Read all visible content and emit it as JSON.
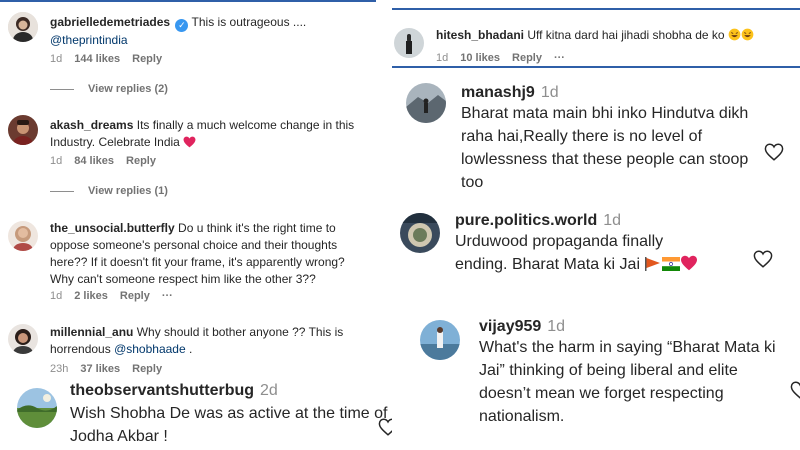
{
  "left_panel": {
    "comments": [
      {
        "username": "gabrielledemetriades",
        "text": "This is outrageous ....",
        "mention": "@theprintindia",
        "time": "1d",
        "likes": "144 likes",
        "reply": "Reply",
        "view_replies": "View replies (2)"
      },
      {
        "username": "akash_dreams",
        "text": "Its finally a much welcome change in this Industry. Celebrate India",
        "time": "1d",
        "likes": "84 likes",
        "reply": "Reply",
        "view_replies": "View replies (1)"
      },
      {
        "username": "the_unsocial.butterfly",
        "text": "Do u think it's the right time to oppose someone's personal choice and their thoughts here?? If it doesn't fit your frame, it's apparently wrong? Why can't someone respect him like the other 3??",
        "time": "1d",
        "likes": "2 likes",
        "reply": "Reply",
        "more": "···"
      },
      {
        "username": "millennial_anu",
        "text": "Why should it bother anyone ?? This is horrendous",
        "mention": "@shobhaade",
        "trail": ".",
        "time": "23h",
        "likes": "37 likes",
        "reply": "Reply"
      }
    ]
  },
  "bottom_left": {
    "username": "theobservantshutterbug",
    "time": "2d",
    "text": "Wish Shobha De was as active at the time of Jodha Akbar !"
  },
  "right_top": {
    "username": "hitesh_bhadani",
    "text": "Uff kitna dard hai jihadi shobha de ko",
    "time": "1d",
    "likes": "10 likes",
    "reply": "Reply",
    "more": "···"
  },
  "right_panel": {
    "comments": [
      {
        "username": "manashj9",
        "time": "1d",
        "text": "Bharat mata main bhi inko Hindutva dikh raha hai,Really there is no level of lowlessness that these people can stoop too"
      },
      {
        "username": "pure.politics.world",
        "time": "1d",
        "text": "Urduwood propaganda finally ending. Bharat Mata ki Jai"
      },
      {
        "username": "vijay959",
        "time": "1d",
        "text": "What's the harm in saying “Bharat Mata ki Jai” thinking of being liberal and elite doesn’t mean we forget respecting nationalism."
      }
    ]
  },
  "colors": {
    "text": "#262626",
    "meta": "#8e8e8e",
    "mention": "#00376b",
    "verified": "#3897f0",
    "divider": "#2f5fa8"
  },
  "icons": [
    "heart-icon",
    "verified-icon",
    "heart-emoji",
    "flag-emoji",
    "laughing-emoji"
  ]
}
